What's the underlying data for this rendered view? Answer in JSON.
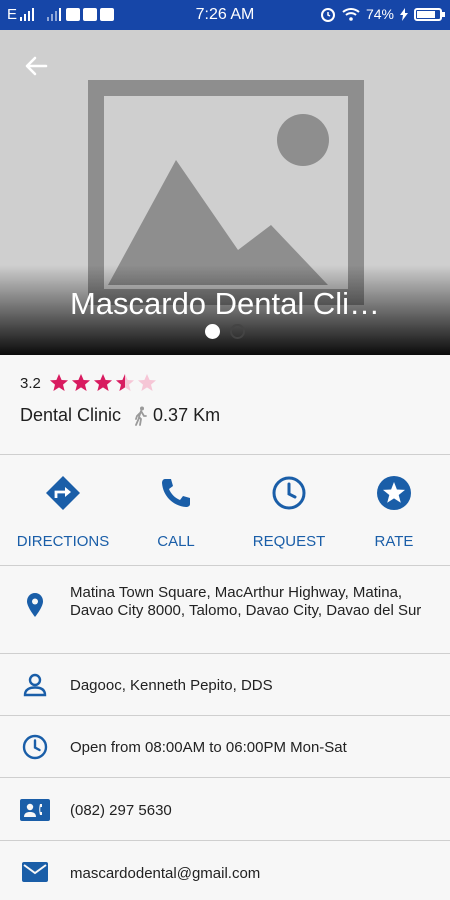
{
  "status_bar": {
    "carrier": "E",
    "time": "7:26 AM",
    "battery": "74%",
    "battery_level": 0.74
  },
  "header": {
    "title": "Mascardo Dental Cli…",
    "image_count": 2,
    "active_image": 0
  },
  "summary": {
    "rating": "3.2",
    "rating_value": 3.2,
    "rating_max": 5,
    "category": "Dental Clinic",
    "distance": "0.37 Km"
  },
  "actions": [
    {
      "label": "DIRECTIONS",
      "icon": "directions-icon"
    },
    {
      "label": "CALL",
      "icon": "phone-icon"
    },
    {
      "label": "REQUEST",
      "icon": "clock-icon"
    },
    {
      "label": "RATE",
      "icon": "star-circle-icon"
    }
  ],
  "details": {
    "address": "Matina Town Square, MacArthur Highway, Matina, Davao City 8000, Talomo, Davao City, Davao del Sur",
    "doctor": "Dagooc, Kenneth Pepito, DDS",
    "hours": "Open from 08:00AM  to 06:00PM Mon-Sat",
    "phone": "(082) 297 5630",
    "email": "mascardodental@gmail.com"
  },
  "colors": {
    "status_bar": "#1646a8",
    "accent": "#1a5ea8",
    "star": "#d81b60"
  }
}
